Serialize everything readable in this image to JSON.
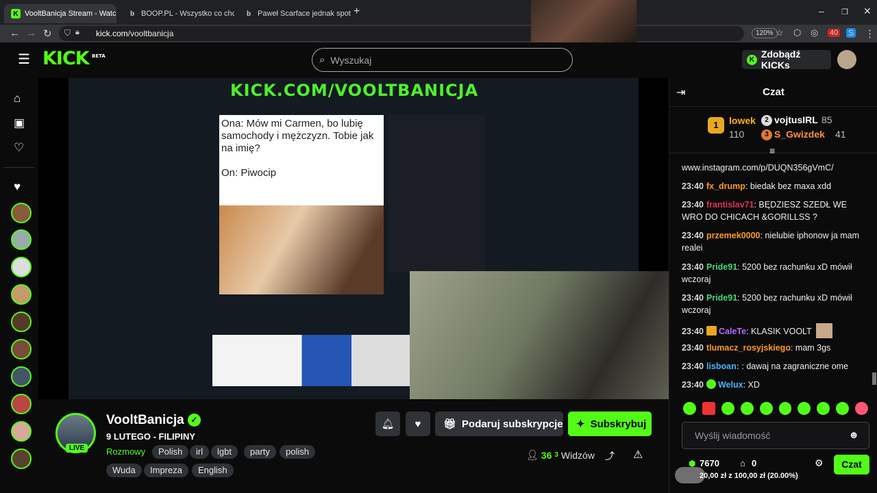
{
  "browser": {
    "tabs": [
      {
        "title": "VooltBanicja Stream - Watch Live",
        "active": true
      },
      {
        "title": "BOOP.PL - Wszystko co chcesz",
        "active": false
      },
      {
        "title": "Paweł Scarface jednak spotykał",
        "active": false
      }
    ],
    "url_host": "kick.com",
    "url_path": "/vooltbanicja",
    "zoom": "120%",
    "extension_badge": "40"
  },
  "header": {
    "logo": "KICK",
    "logo_badge": "BETA",
    "search_placeholder": "Wyszukaj",
    "kicks_label": "Zdobądź KICKs"
  },
  "video": {
    "overlay_text": "KICK.COM/VOOLTBANICJA",
    "meme_text": "Ona: Mów mi Carmen, bo lubię samochody i mężczyzn. Tobie jak na imię?\n\nOn: Piwocip"
  },
  "stream": {
    "channel_name": "VooltBanicja",
    "live_label": "LIVE",
    "title": "9 LUTEGO - FILIPINY",
    "category": "Rozmowy",
    "tags": [
      "Polish",
      "irl",
      "lgbt",
      "party",
      "polish",
      "Wuda",
      "Impreza",
      "English"
    ],
    "gift_label": "Podaruj subskrypcje",
    "subscribe_label": "Subskrybuj",
    "viewers_count": "36",
    "viewers_sup": "3",
    "viewers_label": "Widzów"
  },
  "chat": {
    "title": "Czat",
    "leaderboard": [
      {
        "rank": "1",
        "name": "lowek",
        "value": "110",
        "color": "#ffb020"
      },
      {
        "rank": "2",
        "name": "vojtusIRL",
        "value": "85",
        "color": "#ffffff"
      },
      {
        "rank": "3",
        "name": "S_Gwizdek",
        "value": "41",
        "color": "#ff9040"
      }
    ],
    "messages": [
      {
        "time": "",
        "user": "",
        "color": "#ffffff",
        "text": "www.instagram.com/p/DUQN356gVmC/"
      },
      {
        "time": "23:40",
        "user": "fx_drump",
        "color": "#ff9a1f",
        "text": "biedak bez maxa xdd"
      },
      {
        "time": "23:40",
        "user": "frantislav71",
        "color": "#e0325d",
        "text": "BĘDZIESZ SZEDŁ WE WRO DO CHICACH &GORILLSS ?"
      },
      {
        "time": "23:40",
        "user": "przemek0000",
        "color": "#ff9a1f",
        "text": "nielubie iphonow ja mam realei"
      },
      {
        "time": "23:40",
        "user": "Pride91",
        "color": "#4ad67b",
        "text": "5200 bez rachunku xD mówił wczoraj"
      },
      {
        "time": "23:40",
        "user": "Pride91",
        "color": "#4ad67b",
        "text": "5200 bez rachunku xD mówił wczoraj"
      },
      {
        "time": "23:40",
        "user": "CaleTe",
        "color": "#b469ff",
        "text": "KLASIK VOOLT"
      },
      {
        "time": "23:40",
        "user": "tlumacz_rosyjskiego",
        "color": "#ff9a1f",
        "text": "mam 3gs"
      },
      {
        "time": "23:40",
        "user": "lisboan:",
        "color": "#47b5ff",
        "text": ": dawaj na zagraniczne ome"
      },
      {
        "time": "23:40",
        "user": "Welux",
        "color": "#47b5ff",
        "text": "XD"
      }
    ],
    "input_placeholder": "Wyślij wiadomość",
    "points": "7670",
    "count": "0",
    "send_label": "Czat",
    "goal_text": "20,00 zł z 100,00 zł (20.00%)"
  },
  "colors": {
    "accent": "#53fc18",
    "background": "#0b0b0c",
    "button": "#2f3236"
  }
}
